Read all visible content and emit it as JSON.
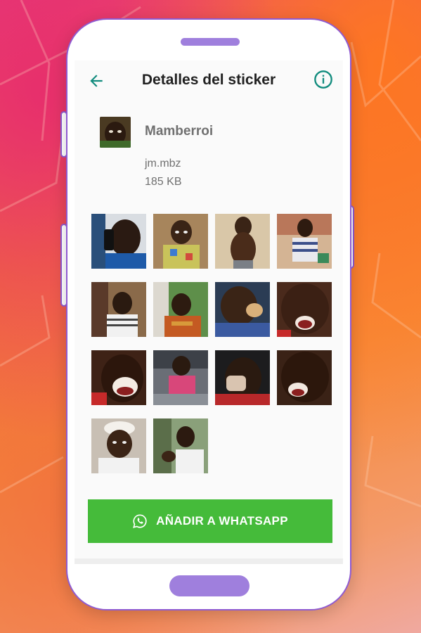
{
  "appbar": {
    "title": "Detalles del sticker",
    "back_icon": "arrow-left-icon",
    "info_icon": "info-circle-icon"
  },
  "pack": {
    "name": "Mamberroi",
    "publisher": "jm.mbz",
    "size": "185 KB"
  },
  "stickers": [
    {
      "name": "sticker-1"
    },
    {
      "name": "sticker-2"
    },
    {
      "name": "sticker-3"
    },
    {
      "name": "sticker-4"
    },
    {
      "name": "sticker-5"
    },
    {
      "name": "sticker-6"
    },
    {
      "name": "sticker-7"
    },
    {
      "name": "sticker-8"
    },
    {
      "name": "sticker-9"
    },
    {
      "name": "sticker-10"
    },
    {
      "name": "sticker-11"
    },
    {
      "name": "sticker-12"
    },
    {
      "name": "sticker-13"
    },
    {
      "name": "sticker-14"
    }
  ],
  "add_button": {
    "label": "AÑADIR A WHATSAPP",
    "icon": "whatsapp-icon"
  },
  "colors": {
    "accent": "#128c7e",
    "button": "#45bb3a",
    "phone_frame": "#8f5bd1"
  }
}
